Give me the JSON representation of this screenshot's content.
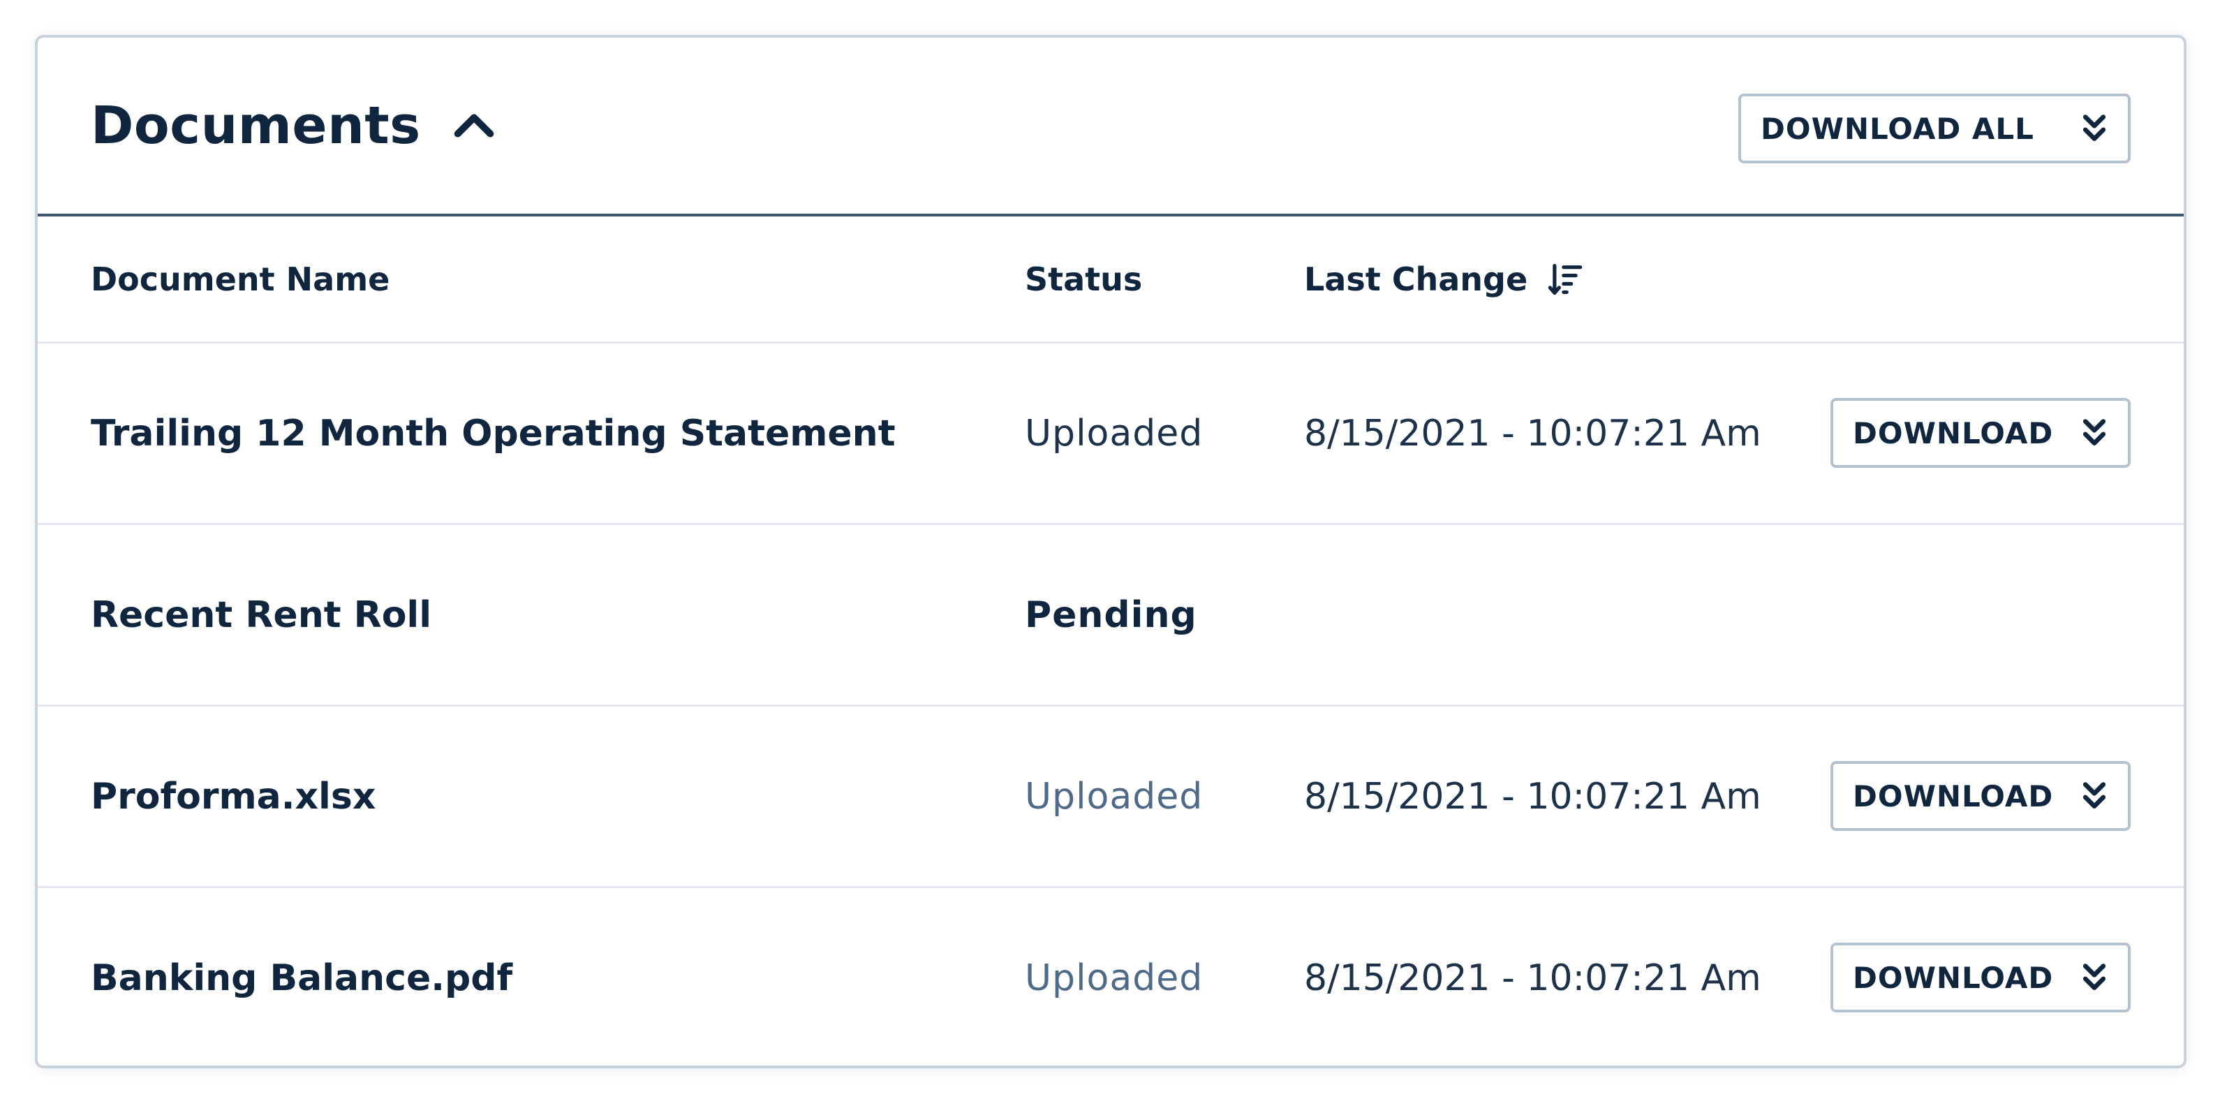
{
  "header": {
    "title": "Documents",
    "toggle_icon": "chevron-up-icon",
    "download_all_label": "DOWNLOAD ALL",
    "download_all_icon": "double-chevron-down-icon"
  },
  "table": {
    "columns": {
      "name": "Document Name",
      "status": "Status",
      "last_change": "Last Change",
      "sort_icon": "sort-descending-icon"
    },
    "rows": [
      {
        "name": "Trailing 12 Month Operating Statement",
        "status": "Uploaded",
        "last_change": "8/15/2021 - 10:07:21 Am",
        "action_label": "DOWNLOAD"
      },
      {
        "name": "Recent Rent Roll",
        "status": "Pending",
        "last_change": "",
        "action_label": ""
      },
      {
        "name": "Proforma.xlsx",
        "status": "Uploaded",
        "last_change": "8/15/2021 - 10:07:21 Am",
        "action_label": "DOWNLOAD"
      },
      {
        "name": "Banking Balance.pdf",
        "status": "Uploaded",
        "last_change": "8/15/2021 - 10:07:21 Am",
        "action_label": "DOWNLOAD"
      }
    ]
  },
  "colors": {
    "text_primary": "#10263f",
    "text_muted": "#4e6a86",
    "border": "#c7d2dc",
    "header_rule": "#3f566e",
    "row_divider": "#e3e8ee"
  }
}
